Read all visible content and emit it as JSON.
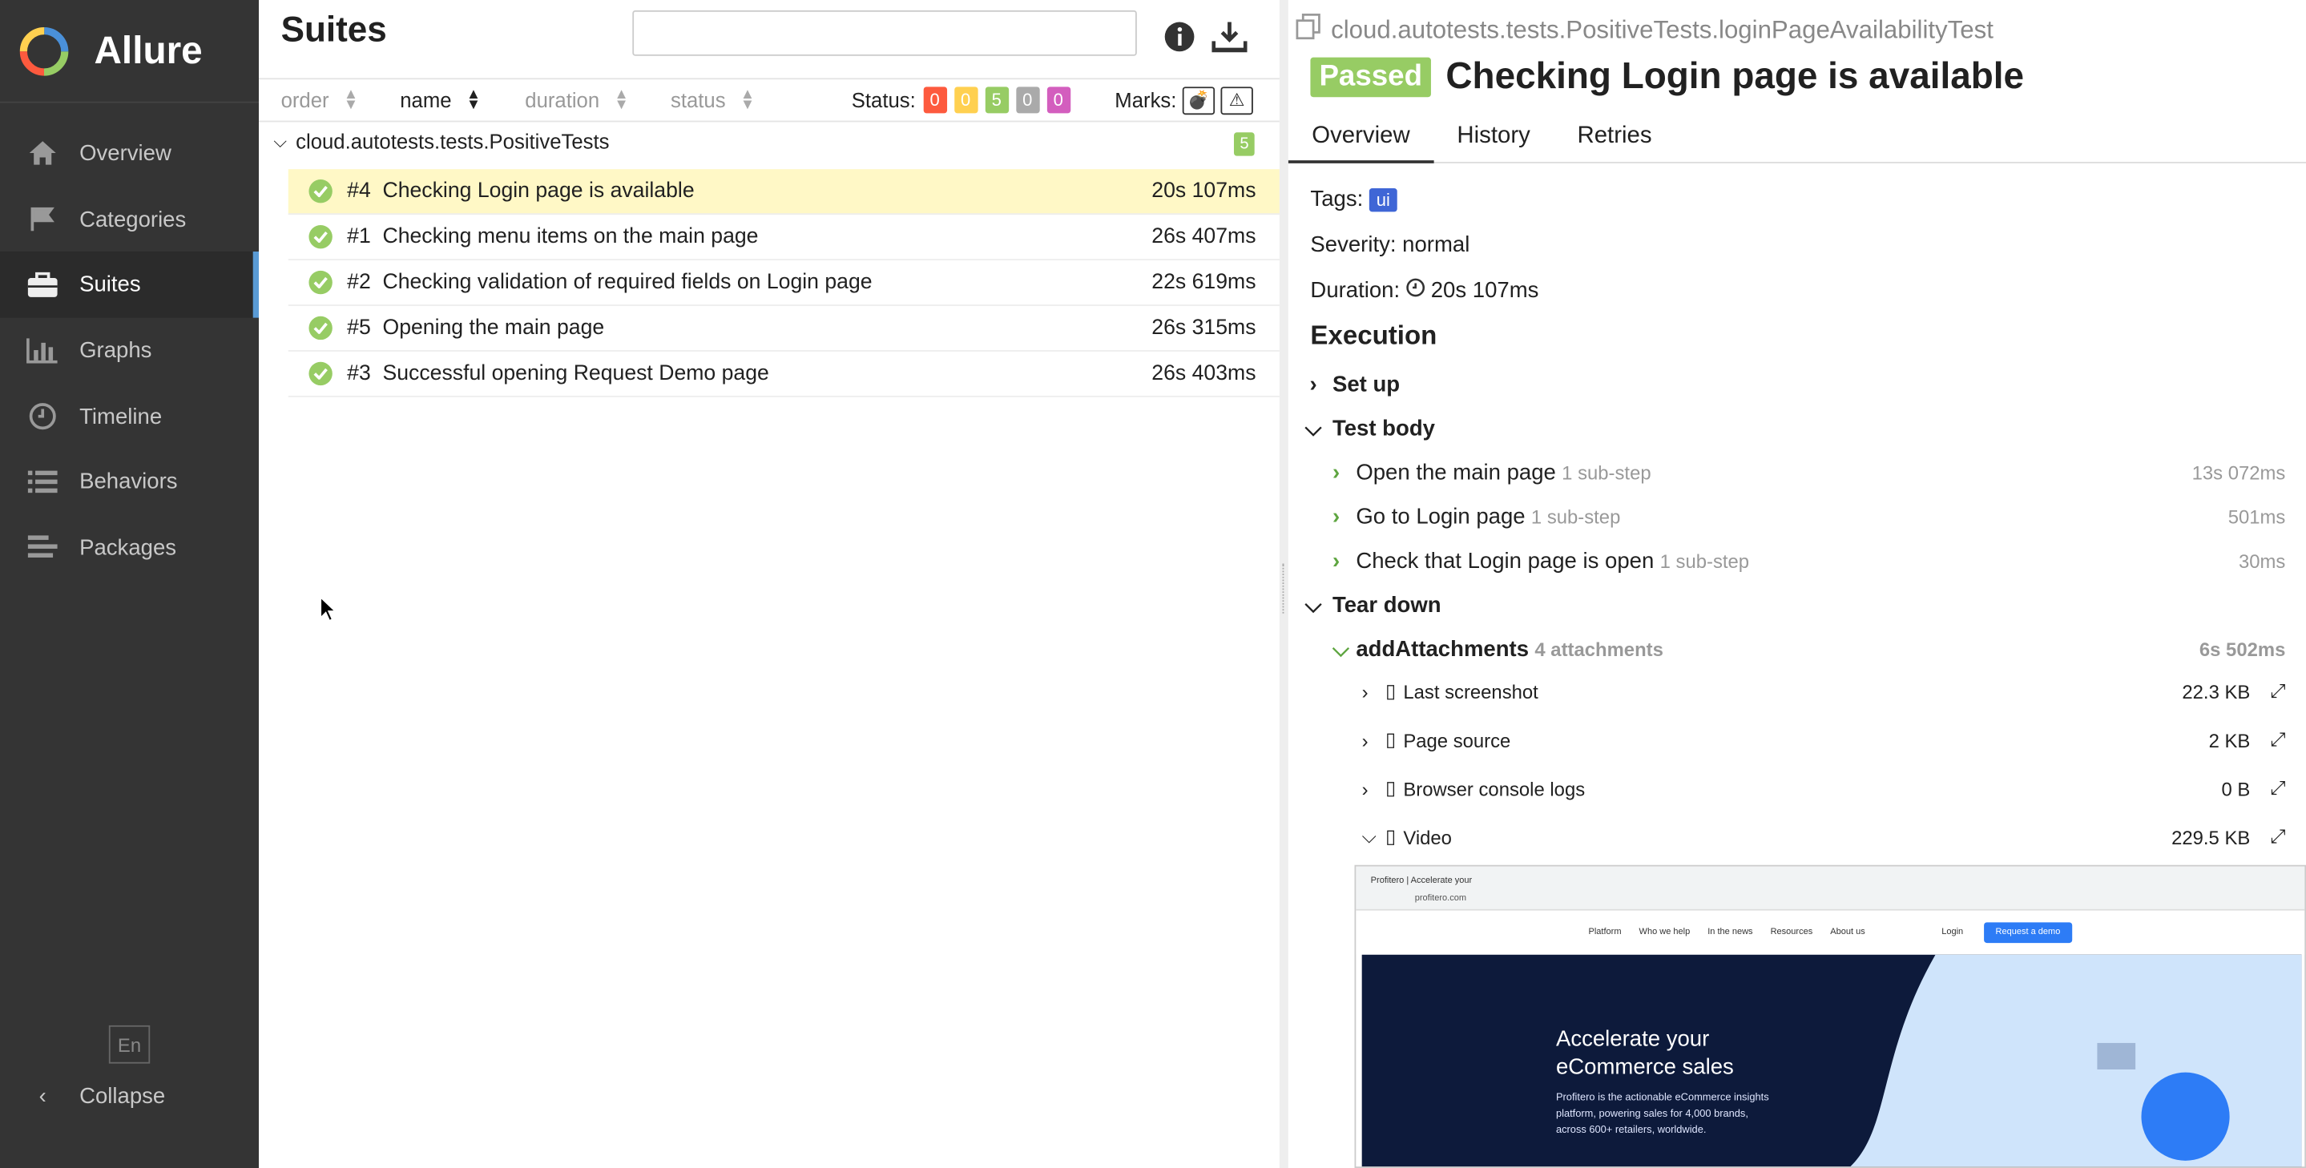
{
  "app": {
    "name": "Allure",
    "lang": "En",
    "collapse": "Collapse"
  },
  "nav": [
    {
      "label": "Overview",
      "icon": "home-icon"
    },
    {
      "label": "Categories",
      "icon": "flag-icon"
    },
    {
      "label": "Suites",
      "icon": "briefcase-icon"
    },
    {
      "label": "Graphs",
      "icon": "bar-chart-icon"
    },
    {
      "label": "Timeline",
      "icon": "clock-icon"
    },
    {
      "label": "Behaviors",
      "icon": "list-icon"
    },
    {
      "label": "Packages",
      "icon": "align-left-icon"
    }
  ],
  "suites": {
    "title": "Suites",
    "search": {
      "value": "",
      "placeholder": ""
    },
    "sort": {
      "order": "order",
      "name": "name",
      "duration": "duration",
      "status": "status"
    },
    "status_label": "Status:",
    "status_counts": [
      {
        "value": "0",
        "color": "#fd5a3e"
      },
      {
        "value": "0",
        "color": "#ffd050"
      },
      {
        "value": "5",
        "color": "#97cc64"
      },
      {
        "value": "0",
        "color": "#aaaaaa"
      },
      {
        "value": "0",
        "color": "#d35ebe"
      }
    ],
    "marks_label": "Marks:",
    "group": {
      "name": "cloud.autotests.tests.PositiveTests",
      "count": "5"
    },
    "rows": [
      {
        "num": "#4",
        "name": "Checking Login page is available",
        "dur": "20s 107ms"
      },
      {
        "num": "#1",
        "name": "Checking menu items on the main page",
        "dur": "26s 407ms"
      },
      {
        "num": "#2",
        "name": "Checking validation of required fields on Login page",
        "dur": "22s 619ms"
      },
      {
        "num": "#5",
        "name": "Opening the main page",
        "dur": "26s 315ms"
      },
      {
        "num": "#3",
        "name": "Successful opening Request Demo page",
        "dur": "26s 403ms"
      }
    ]
  },
  "detail": {
    "path": "cloud.autotests.tests.PositiveTests.loginPageAvailabilityTest",
    "status": "Passed",
    "title": "Checking Login page is available",
    "tabs": [
      "Overview",
      "History",
      "Retries"
    ],
    "tags_label": "Tags:",
    "tag": "ui",
    "severity": "Severity: normal",
    "duration_label": "Duration:",
    "duration": "20s 107ms",
    "execution": "Execution",
    "setup": "Set up",
    "testbody": "Test body",
    "steps": [
      {
        "name": "Open the main page",
        "sub": "1 sub-step",
        "dur": "13s 072ms"
      },
      {
        "name": "Go to Login page",
        "sub": "1 sub-step",
        "dur": "501ms"
      },
      {
        "name": "Check that Login page is open",
        "sub": "1 sub-step",
        "dur": "30ms"
      }
    ],
    "teardown": "Tear down",
    "addatt": {
      "name": "addAttachments",
      "sub": "4 attachments",
      "dur": "6s 502ms"
    },
    "attachments": [
      {
        "name": "Last screenshot",
        "size": "22.3 KB"
      },
      {
        "name": "Page source",
        "size": "2 KB"
      },
      {
        "name": "Browser console logs",
        "size": "0 B"
      },
      {
        "name": "Video",
        "size": "229.5 KB"
      }
    ],
    "video": {
      "tab": "Profitero | Accelerate your",
      "url": "profitero.com",
      "menu": [
        "Platform",
        "Who we help",
        "In the news",
        "Resources",
        "About us"
      ],
      "login": "Login",
      "demo": "Request a demo",
      "headline1": "Accelerate your",
      "headline2": "eCommerce sales",
      "body": "Profitero is the actionable eCommerce insights platform, powering sales for 4,000 brands, across 600+ retailers, worldwide."
    }
  }
}
